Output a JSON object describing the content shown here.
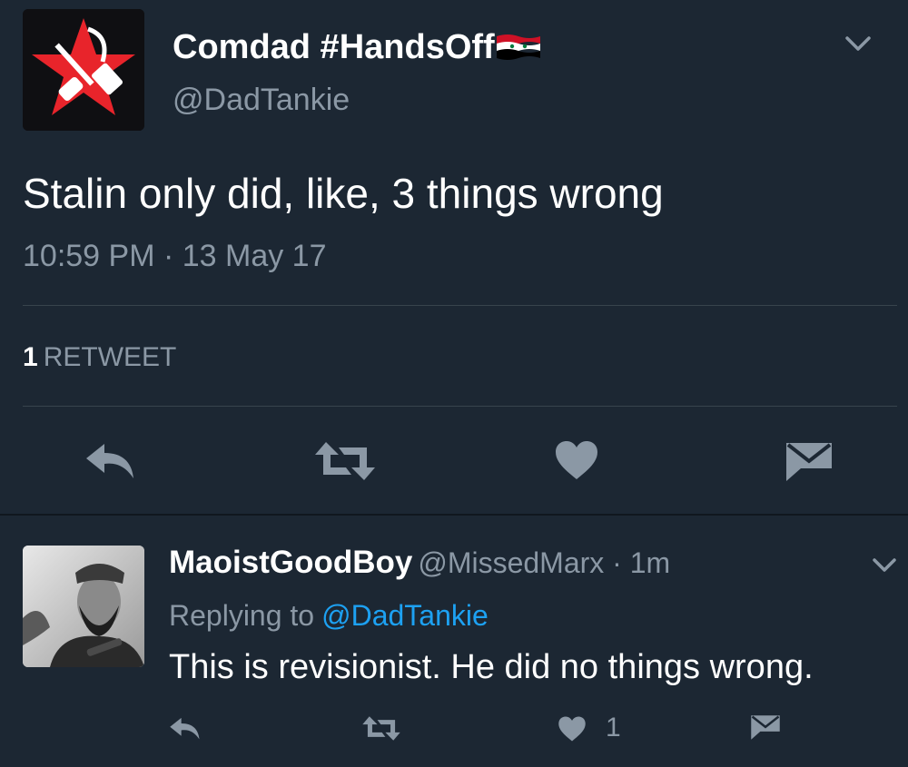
{
  "tweet": {
    "display_name": "Comdad #HandsOff",
    "handle": "@DadTankie",
    "text": "Stalin only did, like, 3 things wrong",
    "timestamp": "10:59 PM · 13 May 17",
    "retweet_count": "1",
    "retweet_label": "RETWEET",
    "icons": {
      "avatar": "red-star-hammer-spatula-icon",
      "flag": "syria-flag-icon",
      "menu": "chevron-down-icon",
      "reply": "reply-icon",
      "retweet": "retweet-icon",
      "like": "heart-icon",
      "message": "direct-message-icon"
    }
  },
  "reply": {
    "display_name": "MaoistGoodBoy",
    "handle_time": "@MissedMarx · 1m",
    "replying_prefix": "Replying to",
    "replying_to": "@DadTankie",
    "text": "This is revisionist. He did no things wrong.",
    "like_count": "1"
  },
  "colors": {
    "background": "#1c2733",
    "text": "#ffffff",
    "secondary": "#8b98a5",
    "link": "#1da1f2",
    "divider": "#38444d",
    "accent_red": "#e8242b"
  }
}
